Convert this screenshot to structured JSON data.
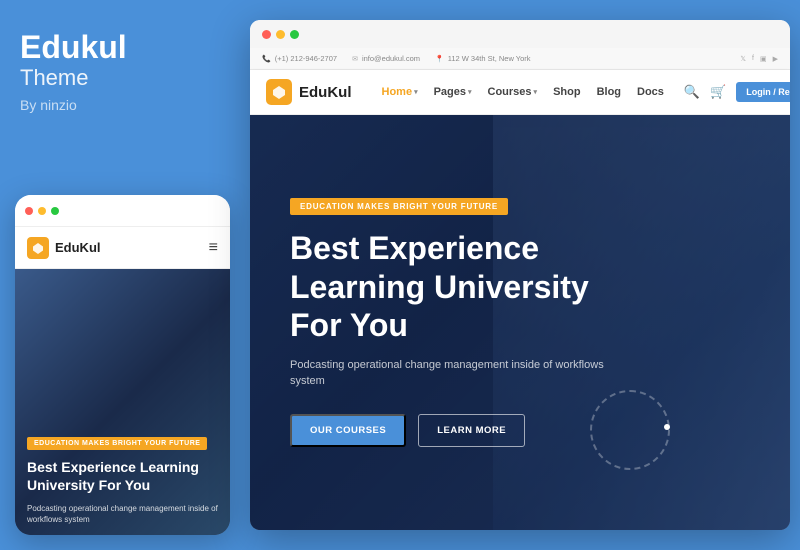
{
  "left": {
    "brand": {
      "title": "Edukul",
      "subtitle": "Theme",
      "by": "By ninzio"
    },
    "mobile": {
      "dots": [
        "red",
        "yellow",
        "green"
      ],
      "logo": "EduKul",
      "badge": "EDUCATION MAKES BRIGHT YOUR FUTURE",
      "title": "Best Experience Learning University For You",
      "subtitle": "Podcasting operational change management inside of workflows system"
    }
  },
  "right": {
    "infobar": {
      "phone": "(+1) 212-946-2707",
      "email": "info@edukul.com",
      "address": "112 W 34th St, New York"
    },
    "nav": {
      "logo": "EduKul",
      "links": [
        {
          "label": "Home",
          "active": true,
          "hasArrow": true
        },
        {
          "label": "Pages",
          "active": false,
          "hasArrow": true
        },
        {
          "label": "Courses",
          "active": false,
          "hasArrow": true
        },
        {
          "label": "Shop",
          "active": false,
          "hasArrow": false
        },
        {
          "label": "Blog",
          "active": false,
          "hasArrow": false
        },
        {
          "label": "Docs",
          "active": false,
          "hasArrow": false
        }
      ],
      "loginBtn": "Login / Register"
    },
    "hero": {
      "badge": "EDUCATION MAKES BRIGHT YOUR FUTURE",
      "title": "Best Experience Learning University For You",
      "subtitle": "Podcasting operational change management inside of workflows system",
      "btnPrimary": "OUR COURSES",
      "btnOutline": "LEARN MORE"
    }
  }
}
